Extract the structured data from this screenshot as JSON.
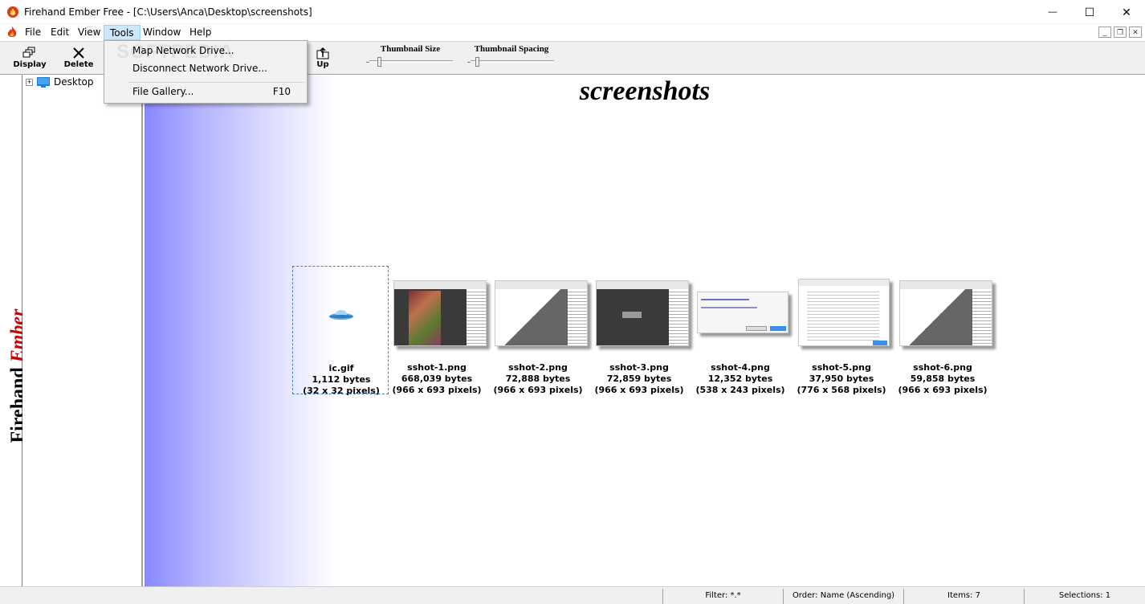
{
  "window": {
    "title": "Firehand Ember Free - [C:\\Users\\Anca\\Desktop\\screenshots]",
    "minimize_glyph": "—",
    "maximize_glyph": "☐",
    "close_glyph": "✕"
  },
  "menubar": {
    "items": [
      "File",
      "Edit",
      "View",
      "Tools",
      "Window",
      "Help"
    ],
    "active": "Tools",
    "mdi_minimize": "_",
    "mdi_restore": "❐",
    "mdi_close": "✕"
  },
  "toolbar": {
    "display_label": "Display",
    "delete_label": "Delete",
    "up_label": "Up",
    "thumbnail_size_label": "Thumbnail Size",
    "thumbnail_spacing_label": "Thumbnail Spacing"
  },
  "tools_menu": {
    "items": [
      {
        "label": "Map Network Drive...",
        "shortcut": ""
      },
      {
        "label": "Disconnect Network Drive...",
        "shortcut": ""
      },
      {
        "label": "File Gallery...",
        "shortcut": "F10"
      }
    ]
  },
  "watermark": "SOFTPEDIA",
  "sidebar": {
    "brand_part1": "Firehand",
    "brand_part2": "Ember"
  },
  "tree": {
    "root_label": "Desktop",
    "expander": "+"
  },
  "content": {
    "folder_title": "screenshots",
    "files": [
      {
        "name": "ic.gif",
        "size": "1,112 bytes",
        "dims": "(32 x 32 pixels)",
        "selected": true
      },
      {
        "name": "sshot-1.png",
        "size": "668,039 bytes",
        "dims": "(966 x 693 pixels)",
        "selected": false
      },
      {
        "name": "sshot-2.png",
        "size": "72,888 bytes",
        "dims": "(966 x 693 pixels)",
        "selected": false
      },
      {
        "name": "sshot-3.png",
        "size": "72,859 bytes",
        "dims": "(966 x 693 pixels)",
        "selected": false
      },
      {
        "name": "sshot-4.png",
        "size": "12,352 bytes",
        "dims": "(538 x 243 pixels)",
        "selected": false
      },
      {
        "name": "sshot-5.png",
        "size": "37,950 bytes",
        "dims": "(776 x 568 pixels)",
        "selected": false
      },
      {
        "name": "sshot-6.png",
        "size": "59,858 bytes",
        "dims": "(966 x 693 pixels)",
        "selected": false
      }
    ]
  },
  "statusbar": {
    "filter": "Filter: *.*",
    "order": "Order: Name (Ascending)",
    "items": "Items: 7",
    "selections": "Selections: 1"
  },
  "colors": {
    "gradient_start": "#8888ff",
    "selection_border": "#3c7ec7",
    "menu_highlight": "#cce8ff",
    "brand_red": "#cc0000"
  }
}
